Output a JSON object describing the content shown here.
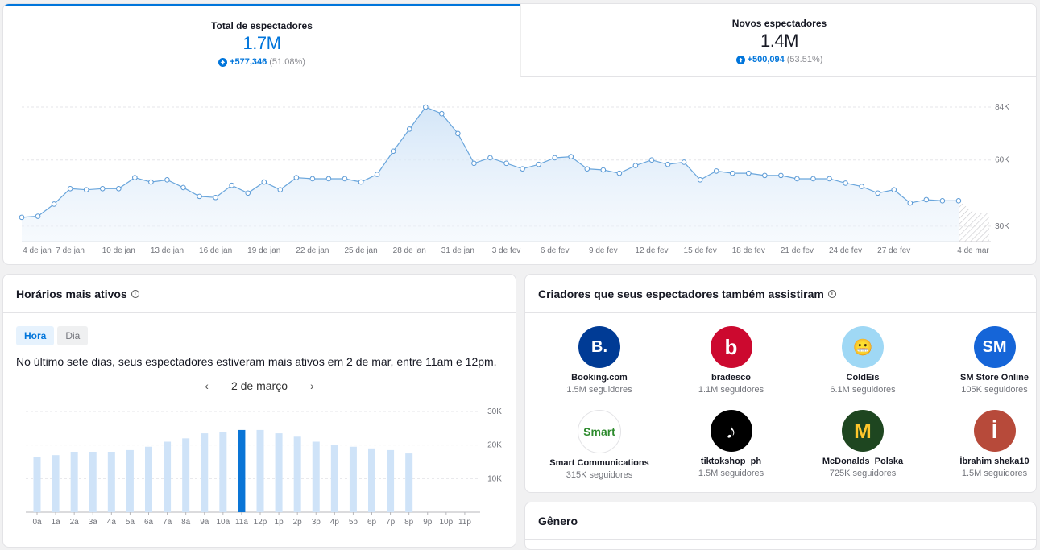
{
  "tabs": [
    {
      "title": "Total de espectadores",
      "value": "1.7M",
      "delta": "+577,346",
      "pct": "(51.08%)"
    },
    {
      "title": "Novos espectadores",
      "value": "1.4M",
      "delta": "+500,094",
      "pct": "(53.51%)"
    }
  ],
  "chart_data": [
    {
      "type": "area",
      "x_labels": [
        "4 de jan",
        "7 de jan",
        "10 de jan",
        "13 de jan",
        "16 de jan",
        "19 de jan",
        "22 de jan",
        "25 de jan",
        "28 de jan",
        "31 de jan",
        "3 de fev",
        "6 de fev",
        "9 de fev",
        "12 de fev",
        "15 de fev",
        "18 de fev",
        "21 de fev",
        "24 de fev",
        "27 de fev",
        "4 de mar"
      ],
      "y_tick_labels": [
        "84K",
        "60K",
        "30K"
      ],
      "values": [
        34000,
        34500,
        40000,
        47000,
        46500,
        47000,
        47000,
        52000,
        50000,
        51000,
        47500,
        43500,
        43000,
        48500,
        45000,
        50000,
        46500,
        52000,
        51500,
        51500,
        51500,
        50000,
        53500,
        64000,
        74000,
        84000,
        81000,
        72000,
        58500,
        61000,
        58500,
        56000,
        58000,
        61000,
        61500,
        56000,
        55500,
        54000,
        57500,
        60000,
        58000,
        59000,
        51000,
        55000,
        54000,
        54000,
        53000,
        53000,
        51500,
        51500,
        51500,
        49500,
        48000,
        45000,
        46500,
        40500,
        42000,
        41500,
        41500,
        36000
      ],
      "pending_last": true,
      "grid": true
    },
    {
      "type": "bar",
      "categories": [
        "0a",
        "1a",
        "2a",
        "3a",
        "4a",
        "5a",
        "6a",
        "7a",
        "8a",
        "9a",
        "10a",
        "11a",
        "12p",
        "1p",
        "2p",
        "3p",
        "4p",
        "5p",
        "6p",
        "7p",
        "8p",
        "9p",
        "10p",
        "11p"
      ],
      "values": [
        16500,
        17000,
        18000,
        18000,
        18000,
        18500,
        19500,
        21000,
        22000,
        23500,
        24000,
        24500,
        24500,
        23500,
        22500,
        21000,
        20000,
        19500,
        19000,
        18500,
        17500,
        0,
        0,
        0
      ],
      "highlight": "11a",
      "y_tick_labels": [
        "30K",
        "20K",
        "10K"
      ],
      "ylim": [
        0,
        30000
      ]
    }
  ],
  "hours": {
    "title": "Horários mais ativos",
    "toggle": [
      "Hora",
      "Dia"
    ],
    "summary": "No último sete dias, seus espectadores estiveram mais ativos em 2 de mar, entre 11am e 12pm.",
    "date": "2 de março"
  },
  "creators": {
    "title": "Criadores que seus espectadores também assistiram",
    "items": [
      {
        "name": "Booking.com",
        "followers": "1.5M seguidores",
        "color": "#003b95",
        "glyph": "B."
      },
      {
        "name": "bradesco",
        "followers": "1.1M seguidores",
        "color": "#cc092f",
        "glyph": "b"
      },
      {
        "name": "ColdEis",
        "followers": "6.1M seguidores",
        "color": "#9fd8f5",
        "glyph": "😬"
      },
      {
        "name": "SM Store Online",
        "followers": "105K seguidores",
        "color": "#1565d8",
        "glyph": "SM"
      },
      {
        "name": "Smart Communications",
        "followers": "315K seguidores",
        "color": "#ffffff",
        "glyph": "Smart"
      },
      {
        "name": "tiktokshop_ph",
        "followers": "1.5M seguidores",
        "color": "#000000",
        "glyph": "♪"
      },
      {
        "name": "McDonalds_Polska",
        "followers": "725K seguidores",
        "color": "#1e4620",
        "glyph": "M"
      },
      {
        "name": "İbrahim sheka10",
        "followers": "1.5M seguidores",
        "color": "#b74a3a",
        "glyph": "İ"
      }
    ]
  },
  "gender": {
    "title": "Gênero"
  }
}
